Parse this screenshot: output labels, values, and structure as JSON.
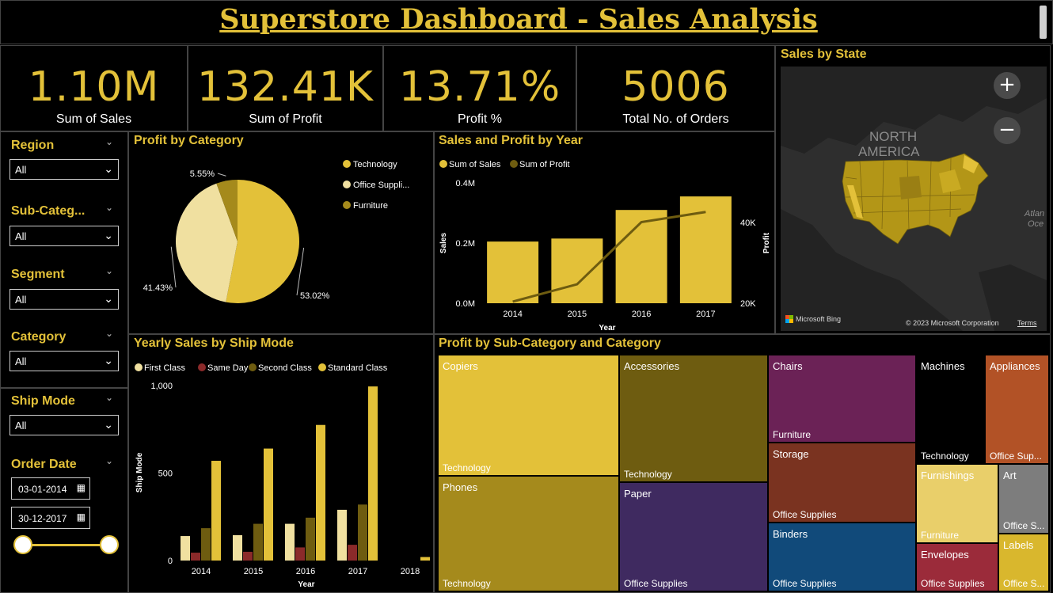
{
  "title": "Superstore Dashboard - Sales Analysis",
  "kpis": [
    {
      "value": "1.10M",
      "label": "Sum of Sales"
    },
    {
      "value": "132.41K",
      "label": "Sum of Profit"
    },
    {
      "value": "13.71%",
      "label": "Profit %"
    },
    {
      "value": "5006",
      "label": "Total No. of Orders"
    }
  ],
  "slicers": {
    "region": {
      "label": "Region",
      "value": "All"
    },
    "subcategory": {
      "label": "Sub-Categ...",
      "value": "All"
    },
    "segment": {
      "label": "Segment",
      "value": "All"
    },
    "category": {
      "label": "Category",
      "value": "All"
    },
    "shipmode": {
      "label": "Ship Mode",
      "value": "All"
    },
    "orderdate": {
      "label": "Order Date",
      "start": "03-01-2014",
      "end": "30-12-2017",
      "range_fraction": [
        0,
        1
      ]
    }
  },
  "icons": {
    "chevron": "chevron-down-icon",
    "calendar": "calendar-icon"
  },
  "map": {
    "title": "Sales by State",
    "labels": {
      "continent": "NORTH\nAMERICA",
      "continent_l1": "NORTH",
      "continent_l2": "AMERICA",
      "ocean_l1": "Atlan",
      "ocean_l2": "Oce"
    },
    "zoom_in": "+",
    "zoom_out": "−",
    "bing": "Microsoft Bing",
    "copyright": "© 2023 Microsoft Corporation",
    "terms": "Terms"
  },
  "colors": {
    "gold": "#e3c139",
    "dark_gold": "#6e5c10",
    "mid_gold": "#a58a1c",
    "pale": "#f0e0a0"
  },
  "chart_data": [
    {
      "id": "profit_by_category",
      "type": "pie",
      "title": "Profit by Category",
      "slices": [
        {
          "label": "Technology",
          "value": 53.02,
          "display": "53.02%",
          "color": "#e3c139"
        },
        {
          "label": "Office Suppli...",
          "value": 41.43,
          "display": "41.43%",
          "color": "#f0e0a0"
        },
        {
          "label": "Furniture",
          "value": 5.55,
          "display": "5.55%",
          "color": "#a58a1c"
        }
      ]
    },
    {
      "id": "sales_profit_by_year",
      "type": "bar",
      "title": "Sales and Profit by Year",
      "legend": [
        "Sum of Sales",
        "Sum of Profit"
      ],
      "categories": [
        "2014",
        "2015",
        "2016",
        "2017"
      ],
      "series": [
        {
          "name": "Sum of Sales",
          "values": [
            0.205,
            0.215,
            0.31,
            0.355
          ],
          "unit": "M",
          "color": "#e3c139"
        },
        {
          "name": "Sum of Profit",
          "values": [
            20.4,
            24.7,
            40.1,
            42.6
          ],
          "unit": "K",
          "color": "#6e5c10"
        }
      ],
      "xlabel": "Year",
      "ylabel": "Sales",
      "y2label": "Profit",
      "yticks": [
        "0.0M",
        "0.2M",
        "0.4M"
      ],
      "ylim": [
        0,
        0.4
      ],
      "y2ticks": [
        "20K",
        "40K"
      ],
      "y2lim": [
        20,
        40
      ]
    },
    {
      "id": "yearly_sales_by_shipmode",
      "type": "bar",
      "title": "Yearly Sales by Ship Mode",
      "categories": [
        "2014",
        "2015",
        "2016",
        "2017",
        "2018"
      ],
      "series": [
        {
          "name": "First Class",
          "values": [
            140,
            145,
            210,
            290,
            0
          ],
          "color": "#f0e0a0"
        },
        {
          "name": "Same Day",
          "values": [
            45,
            50,
            75,
            90,
            0
          ],
          "color": "#8b2a2a"
        },
        {
          "name": "Second Class",
          "values": [
            185,
            210,
            245,
            320,
            0
          ],
          "color": "#6e5c10"
        },
        {
          "name": "Standard Class",
          "values": [
            570,
            640,
            775,
            995,
            20
          ],
          "color": "#e3c139"
        }
      ],
      "xlabel": "Year",
      "ylabel": "Ship Mode",
      "yticks": [
        "0",
        "500",
        "1,000"
      ],
      "ylim": [
        0,
        1000
      ]
    },
    {
      "id": "profit_by_subcategory",
      "type": "heatmap",
      "title": "Profit by Sub-Category and Category",
      "cells": [
        {
          "name": "Copiers",
          "category": "Technology",
          "color": "#e3c139"
        },
        {
          "name": "Phones",
          "category": "Technology",
          "color": "#a58a1c"
        },
        {
          "name": "Accessories",
          "category": "Technology",
          "color": "#6e5c10"
        },
        {
          "name": "Paper",
          "category": "Office Supplies",
          "color": "#3f2a60"
        },
        {
          "name": "Chairs",
          "category": "Furniture",
          "color": "#6b2256"
        },
        {
          "name": "Storage",
          "category": "Office Supplies",
          "color": "#7a3320"
        },
        {
          "name": "Binders",
          "category": "Office Supplies",
          "color": "#114a7a"
        },
        {
          "name": "Machines",
          "category": "Technology",
          "color": "#000000"
        },
        {
          "name": "Appliances",
          "category": "Office Sup...",
          "color": "#b25226"
        },
        {
          "name": "Furnishings",
          "category": "Furniture",
          "color": "#e9cf6a"
        },
        {
          "name": "Art",
          "category": "Office S...",
          "color": "#7d7d7d"
        },
        {
          "name": "Envelopes",
          "category": "Office Supplies",
          "color": "#9b2b3a"
        },
        {
          "name": "Labels",
          "category": "Office S...",
          "color": "#d9b72d"
        }
      ]
    }
  ]
}
